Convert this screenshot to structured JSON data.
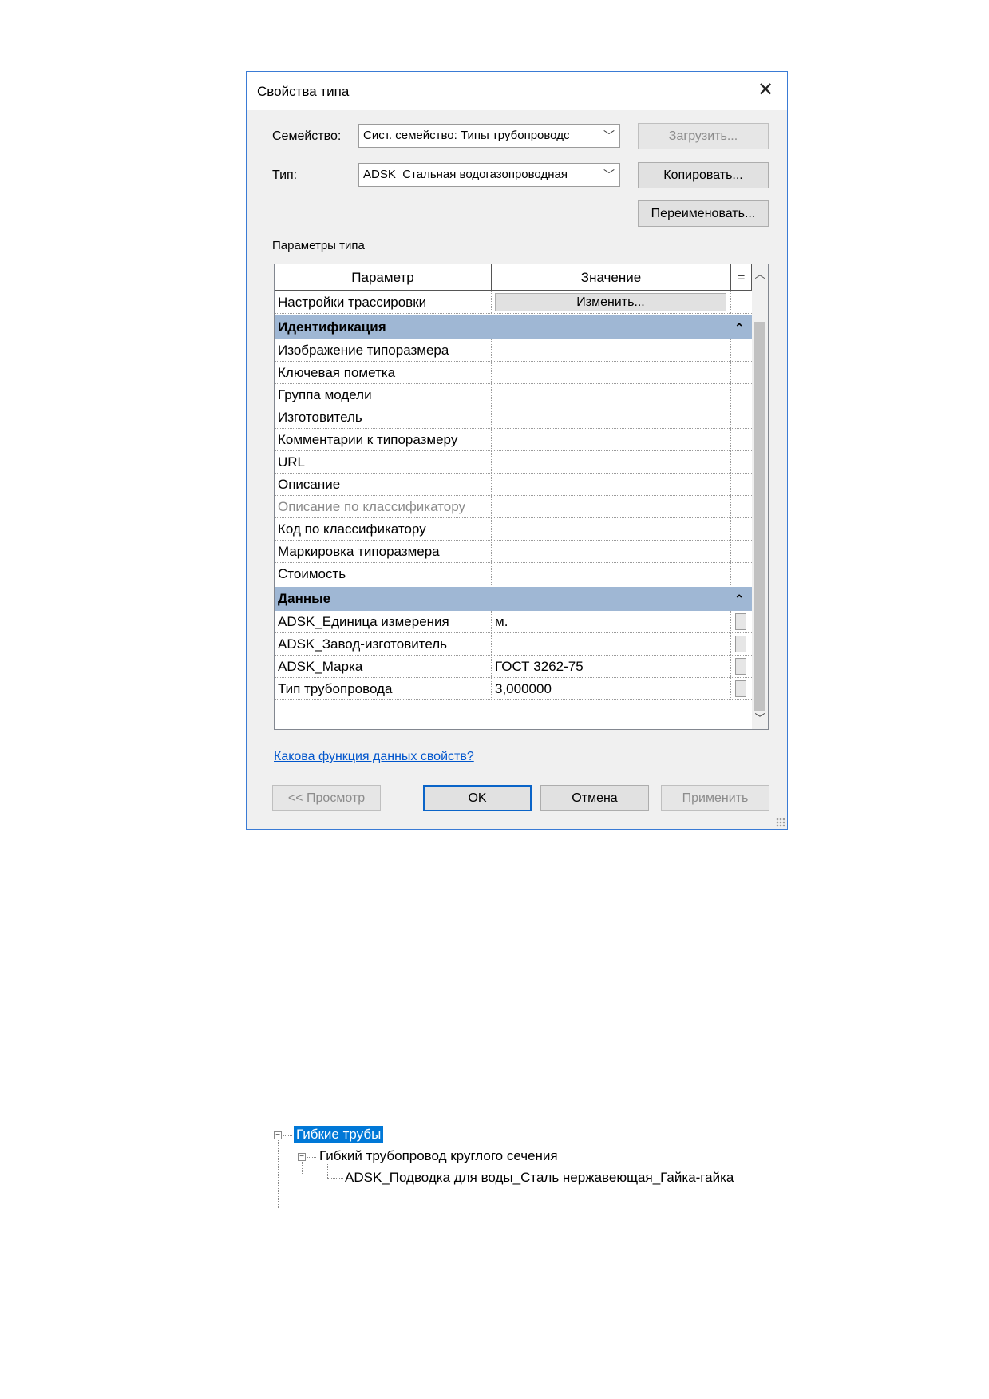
{
  "dialog": {
    "title": "Свойства типа",
    "family_label": "Семейство:",
    "family_value": "Сист. семейство: Типы трубопроводс",
    "type_label": "Тип:",
    "type_value": "ADSK_Стальная водогазопроводная_",
    "load_button": "Загрузить...",
    "copy_button": "Копировать...",
    "rename_button": "Переименовать...",
    "type_params_label": "Параметры типа",
    "grid": {
      "col_param": "Параметр",
      "col_value": "Значение",
      "col_eq": "=",
      "routing_row": {
        "param": "Настройки трассировки",
        "button": "Изменить..."
      },
      "group_ident": "Идентификация",
      "ident_rows": [
        {
          "param": "Изображение типоразмера",
          "value": ""
        },
        {
          "param": "Ключевая пометка",
          "value": ""
        },
        {
          "param": "Группа модели",
          "value": ""
        },
        {
          "param": "Изготовитель",
          "value": ""
        },
        {
          "param": "Комментарии к типоразмеру",
          "value": ""
        },
        {
          "param": "URL",
          "value": ""
        },
        {
          "param": "Описание",
          "value": ""
        },
        {
          "param": "Описание по классификатору",
          "value": ""
        },
        {
          "param": "Код по классификатору",
          "value": ""
        },
        {
          "param": "Маркировка типоразмера",
          "value": ""
        },
        {
          "param": "Стоимость",
          "value": ""
        }
      ],
      "group_data": "Данные",
      "data_rows": [
        {
          "param": "ADSK_Единица измерения",
          "value": "м."
        },
        {
          "param": "ADSK_Завод-изготовитель",
          "value": ""
        },
        {
          "param": "ADSK_Марка",
          "value": "ГОСТ 3262-75"
        },
        {
          "param": "Тип трубопровода",
          "value": "3,000000"
        }
      ]
    },
    "help_link": "Какова функция данных свойств?",
    "preview_button": "<< Просмотр",
    "ok_button": "OK",
    "cancel_button": "Отмена",
    "apply_button": "Применить"
  },
  "tree": {
    "root": "Гибкие трубы",
    "child": "Гибкий трубопровод круглого сечения",
    "leaf": "ADSK_Подводка для воды_Сталь нержавеющая_Гайка-гайка"
  },
  "colors": {
    "accent": "#0078d7",
    "group_header": "#9fb7d4",
    "dialog_border": "#3a7bd5"
  }
}
